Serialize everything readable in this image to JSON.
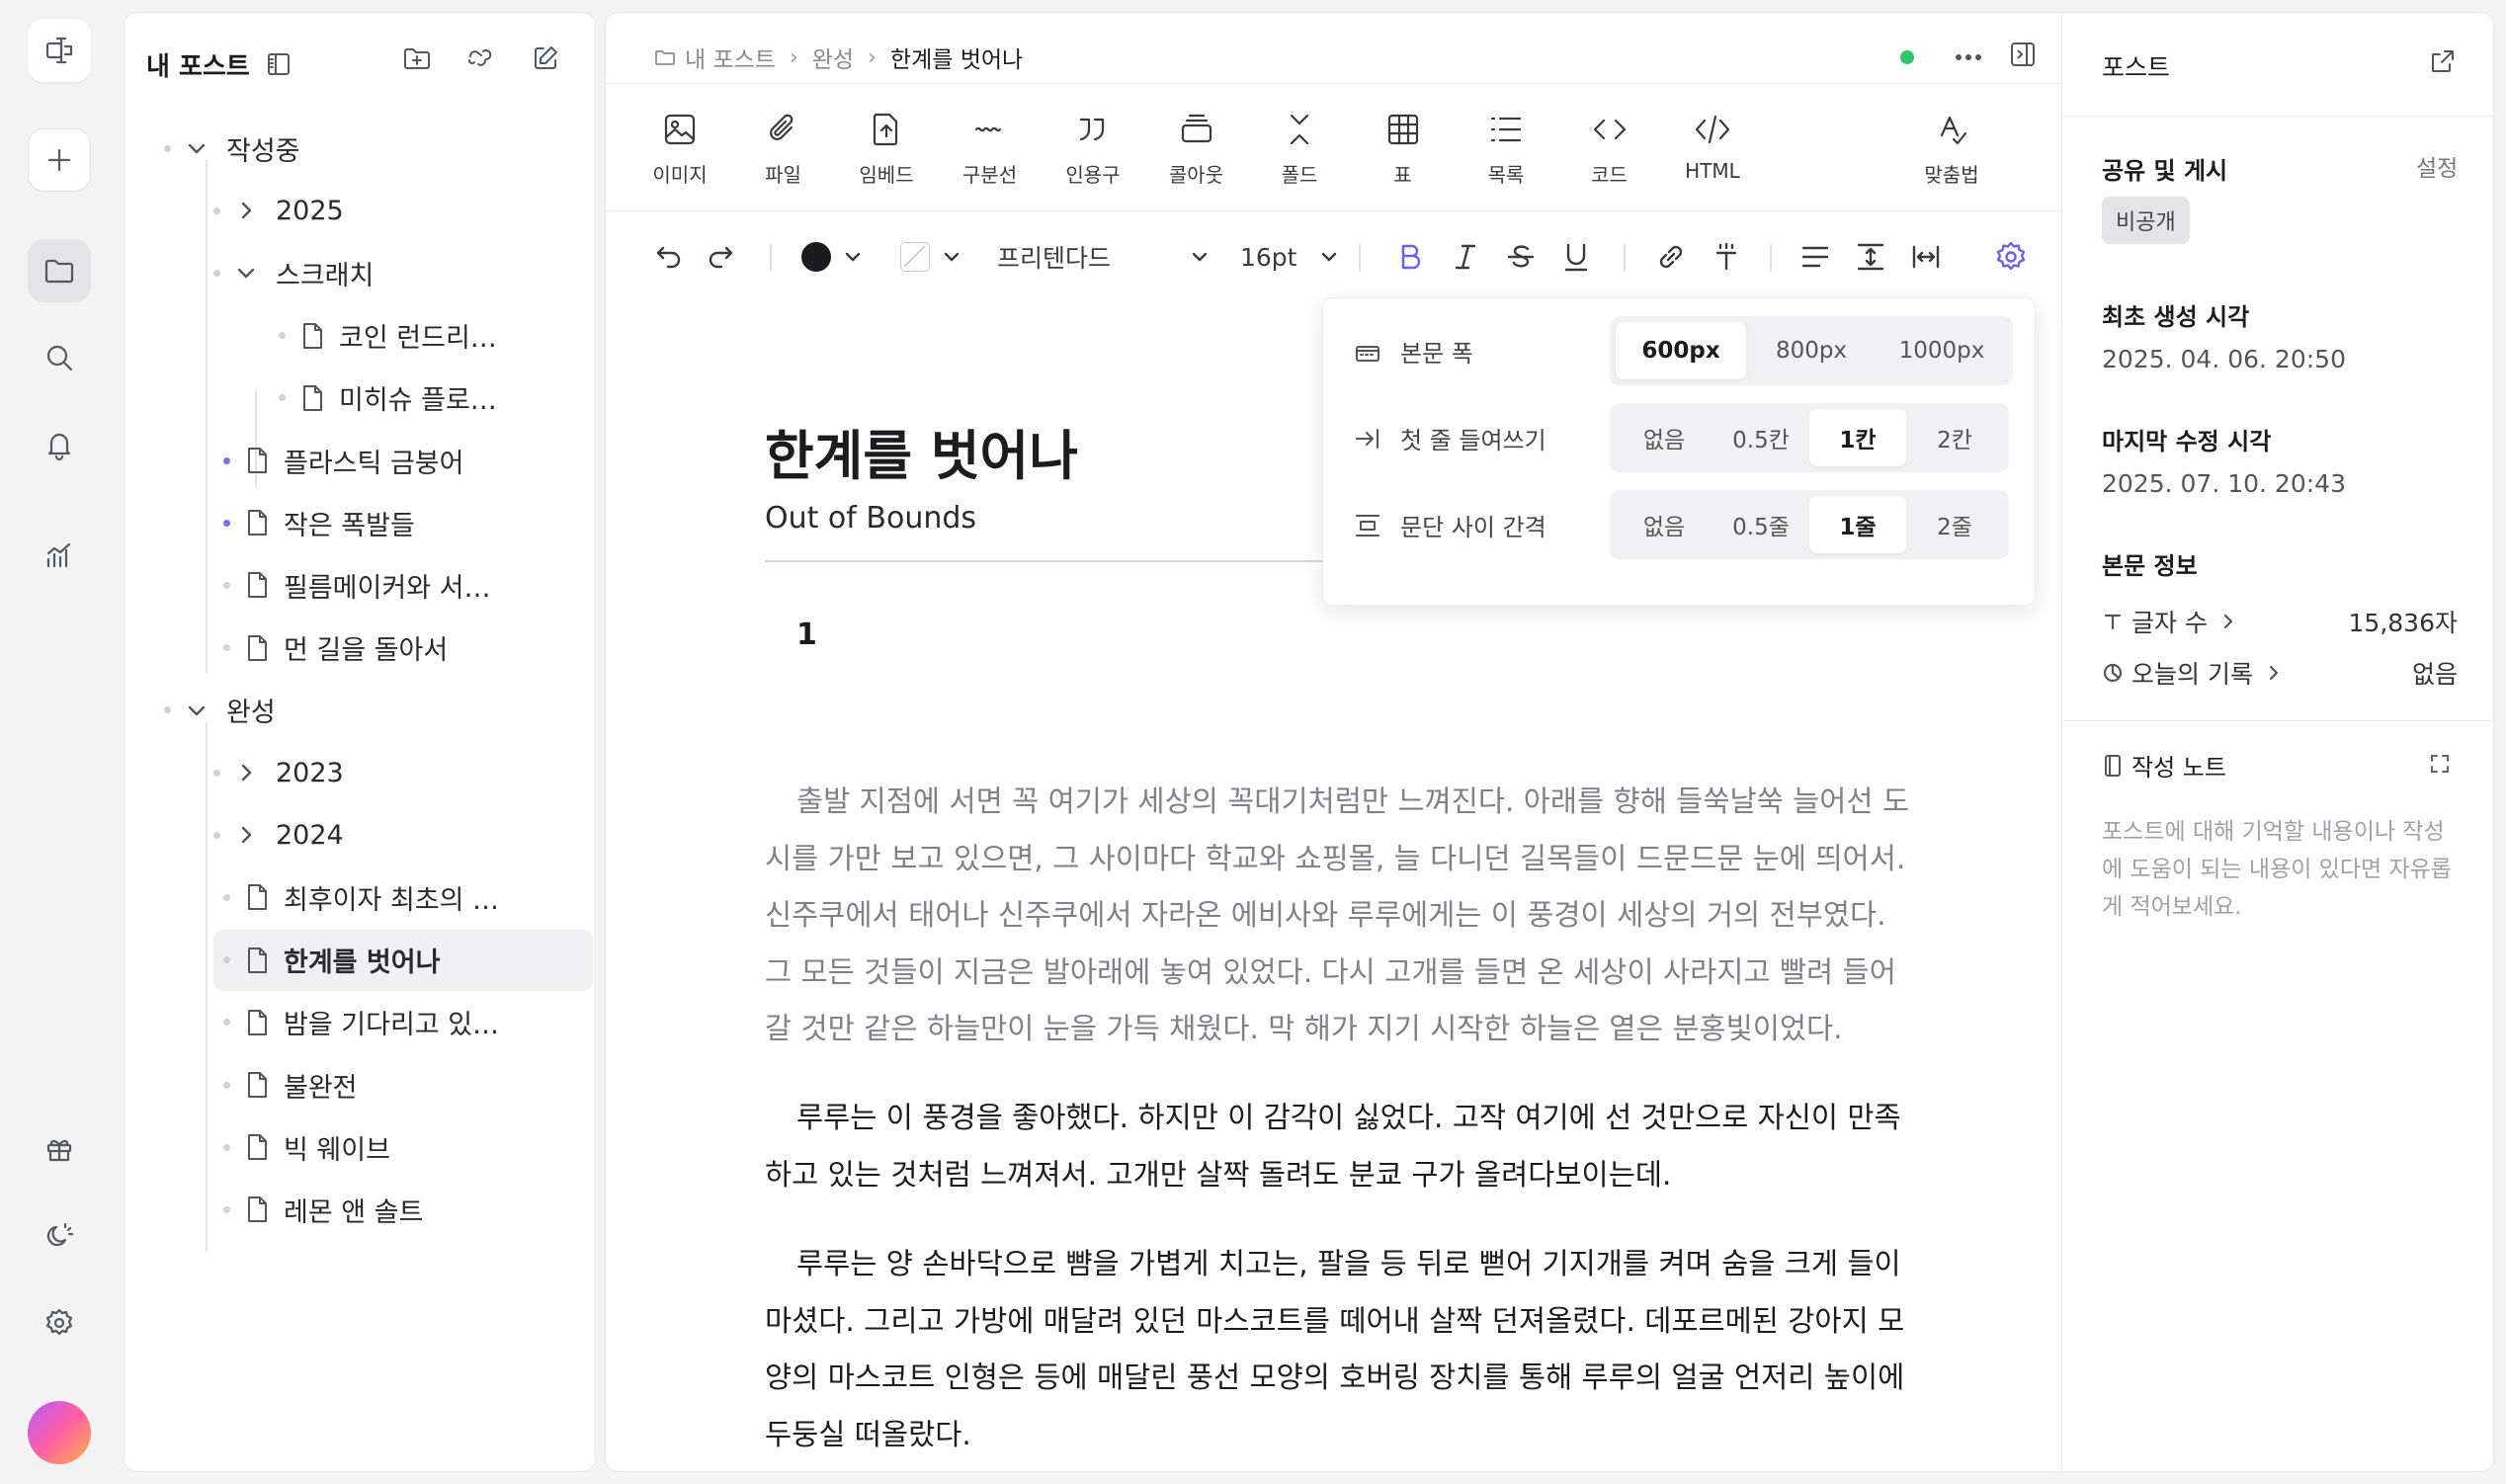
{
  "sidebar": {
    "title": "내 포스트",
    "tree": [
      {
        "label": "작성중",
        "type": "folder",
        "expanded": true,
        "level": 0
      },
      {
        "label": "2025",
        "type": "folder",
        "expanded": false,
        "level": 1
      },
      {
        "label": "스크래치",
        "type": "folder",
        "expanded": true,
        "level": 1
      },
      {
        "label": "코인 런드리…",
        "type": "doc",
        "level": 2
      },
      {
        "label": "미히슈 플로…",
        "type": "doc",
        "level": 2
      },
      {
        "label": "플라스틱 금붕어",
        "type": "doc",
        "level": 1,
        "accent": true
      },
      {
        "label": "작은 폭발들",
        "type": "doc",
        "level": 1,
        "accent": true
      },
      {
        "label": "필름메이커와 서…",
        "type": "doc",
        "level": 1
      },
      {
        "label": "먼 길을 돌아서",
        "type": "doc",
        "level": 1
      },
      {
        "label": "완성",
        "type": "folder",
        "expanded": true,
        "level": 0
      },
      {
        "label": "2023",
        "type": "folder",
        "expanded": false,
        "level": 1
      },
      {
        "label": "2024",
        "type": "folder",
        "expanded": false,
        "level": 1
      },
      {
        "label": "최후이자 최초의 …",
        "type": "doc",
        "level": 1
      },
      {
        "label": "한계를 벗어나",
        "type": "doc",
        "level": 1,
        "selected": true
      },
      {
        "label": "밤을 기다리고 있…",
        "type": "doc",
        "level": 1
      },
      {
        "label": "불완전",
        "type": "doc",
        "level": 1
      },
      {
        "label": "빅 웨이브",
        "type": "doc",
        "level": 1
      },
      {
        "label": "레몬 앤 솔트",
        "type": "doc",
        "level": 1
      }
    ]
  },
  "breadcrumb": {
    "root": "내 포스트",
    "folder": "완성",
    "current": "한계를 벗어나"
  },
  "insert_toolbar": [
    {
      "label": "이미지",
      "icon": "image-icon"
    },
    {
      "label": "파일",
      "icon": "paperclip-icon"
    },
    {
      "label": "임베드",
      "icon": "embed-icon"
    },
    {
      "label": "구분선",
      "icon": "divider-icon"
    },
    {
      "label": "인용구",
      "icon": "quote-icon"
    },
    {
      "label": "콜아웃",
      "icon": "callout-icon"
    },
    {
      "label": "폴드",
      "icon": "fold-icon"
    },
    {
      "label": "표",
      "icon": "table-icon"
    },
    {
      "label": "목록",
      "icon": "list-icon"
    },
    {
      "label": "코드",
      "icon": "code-icon"
    },
    {
      "label": "HTML",
      "icon": "html-icon"
    }
  ],
  "spellcheck_label": "맞춤법",
  "format_toolbar": {
    "text_color": "#1c1c1e",
    "font_name": "프리텐다드",
    "font_size": "16pt"
  },
  "settings_popover": {
    "rows": [
      {
        "label": "본문 폭",
        "icon": "width-icon",
        "options": [
          "600px",
          "800px",
          "1000px"
        ],
        "selected": "600px"
      },
      {
        "label": "첫 줄 들여쓰기",
        "icon": "indent-icon",
        "options": [
          "없음",
          "0.5칸",
          "1칸",
          "2칸"
        ],
        "selected": "1칸"
      },
      {
        "label": "문단 사이 간격",
        "icon": "spacing-icon",
        "options": [
          "없음",
          "0.5줄",
          "1줄",
          "2줄"
        ],
        "selected": "1줄"
      }
    ]
  },
  "document": {
    "title": "한계를 벗어나",
    "subtitle": "Out of Bounds",
    "chapter": "1",
    "paragraphs": [
      "출발 지점에 서면 꼭 여기가 세상의 꼭대기처럼만 느껴진다. 아래를 향해 들쑥날쑥 늘어선 도시를 가만 보고 있으면, 그 사이마다 학교와 쇼핑몰, 늘 다니던 길목들이 드문드문 눈에 띄어서. 신주쿠에서 태어나 신주쿠에서 자라온 에비사와 루루에게는 이 풍경이 세상의 거의 전부였다. 그 모든 것들이 지금은 발아래에 놓여 있었다. 다시 고개를 들면 온 세상이 사라지고 빨려 들어갈 것만 같은 하늘만이 눈을 가득 채웠다. 막 해가 지기 시작한 하늘은 옅은 분홍빛이었다.",
      "루루는 이 풍경을 좋아했다. 하지만 이 감각이 싫었다. 고작 여기에 선 것만으로 자신이 만족하고 있는 것처럼 느껴져서. 고개만 살짝 돌려도 분쿄 구가 올려다보이는데.",
      "루루는 양 손바닥으로 뺨을 가볍게 치고는, 팔을 등 뒤로 뻗어 기지개를 켜며 숨을 크게 들이마셨다. 그리고 가방에 매달려 있던 마스코트를 떼어내 살짝 던져올렸다. 데포르메된 강아지 모양의 마스코트 인형은 등에 매달린 풍선 모양의 호버링 장치를 통해 루루의 얼굴 언저리 높이에 두둥실 떠올랐다."
    ]
  },
  "inspector": {
    "title": "포스트",
    "share_heading": "공유 및 게시",
    "share_setting": "설정",
    "visibility": "비공개",
    "created_heading": "최초 생성 시각",
    "created_value": "2025. 04. 06. 20:50",
    "modified_heading": "마지막 수정 시각",
    "modified_value": "2025. 07. 10. 20:43",
    "info_heading": "본문 정보",
    "char_count_label": "글자 수",
    "char_count_value": "15,836자",
    "today_label": "오늘의 기록",
    "today_value": "없음",
    "note_heading": "작성 노트",
    "note_placeholder": "포스트에 대해 기억할 내용이나 작성에 도움이 되는 내용이 있다면 자유롭게 적어보세요."
  },
  "colors": {
    "accent": "#7b6ef6",
    "status": "#2cc86a"
  }
}
